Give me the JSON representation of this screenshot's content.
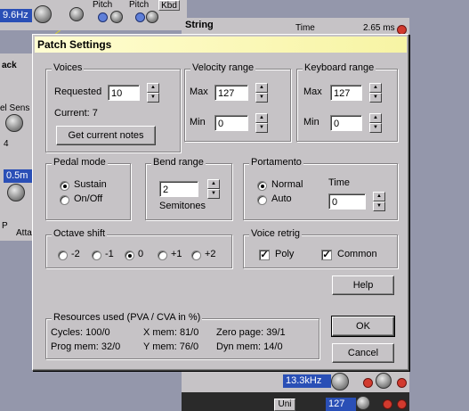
{
  "background": {
    "freq_readout": "9.6Hz",
    "pitch_labels": [
      "Pitch",
      "Pitch"
    ],
    "kbd_label": "Kbd",
    "string_label": "String",
    "time_label": "Time",
    "time_value": "2.65 ms",
    "side_labels": [
      "ack",
      "el Sens",
      "4",
      "0.5m",
      "P",
      "Atta"
    ],
    "lower_readout": "13.3kHz",
    "bottom_readout": "127",
    "uni_label": "Uni",
    "colors": {
      "readout": "#2a4fb6",
      "led": "#d23a2e",
      "knob_dot": "#5f7fd8"
    }
  },
  "dialog": {
    "title": "Patch Settings",
    "voices": {
      "title": "Voices",
      "requested_label": "Requested",
      "requested_value": "10",
      "current_text": "Current: 7",
      "get_current_button": "Get current notes"
    },
    "velocity": {
      "title": "Velocity range",
      "max_label": "Max",
      "max_value": "127",
      "min_label": "Min",
      "min_value": "0"
    },
    "keyboard": {
      "title": "Keyboard range",
      "max_label": "Max",
      "max_value": "127",
      "min_label": "Min",
      "min_value": "0"
    },
    "pedal": {
      "title": "Pedal mode",
      "options": [
        "Sustain",
        "On/Off"
      ],
      "selected": "Sustain"
    },
    "bend": {
      "title": "Bend range",
      "value": "2",
      "unit_label": "Semitones"
    },
    "portamento": {
      "title": "Portamento",
      "options": [
        "Normal",
        "Auto"
      ],
      "selected": "Normal",
      "time_label": "Time",
      "time_value": "0"
    },
    "octave": {
      "title": "Octave shift",
      "options": [
        "-2",
        "-1",
        "0",
        "+1",
        "+2"
      ],
      "selected": "0"
    },
    "retrig": {
      "title": "Voice retrig",
      "poly_label": "Poly",
      "poly_checked": true,
      "common_label": "Common",
      "common_checked": true
    },
    "help_button": "Help",
    "resources": {
      "title": "Resources used (PVA / CVA in %)",
      "cycles": "Cycles: 100/0",
      "xmem": "X mem: 81/0",
      "zeropage": "Zero page: 39/1",
      "progmem": "Prog mem: 32/0",
      "ymem": "Y mem: 76/0",
      "dynmem": "Dyn mem: 14/0"
    },
    "ok_button": "OK",
    "cancel_button": "Cancel"
  }
}
